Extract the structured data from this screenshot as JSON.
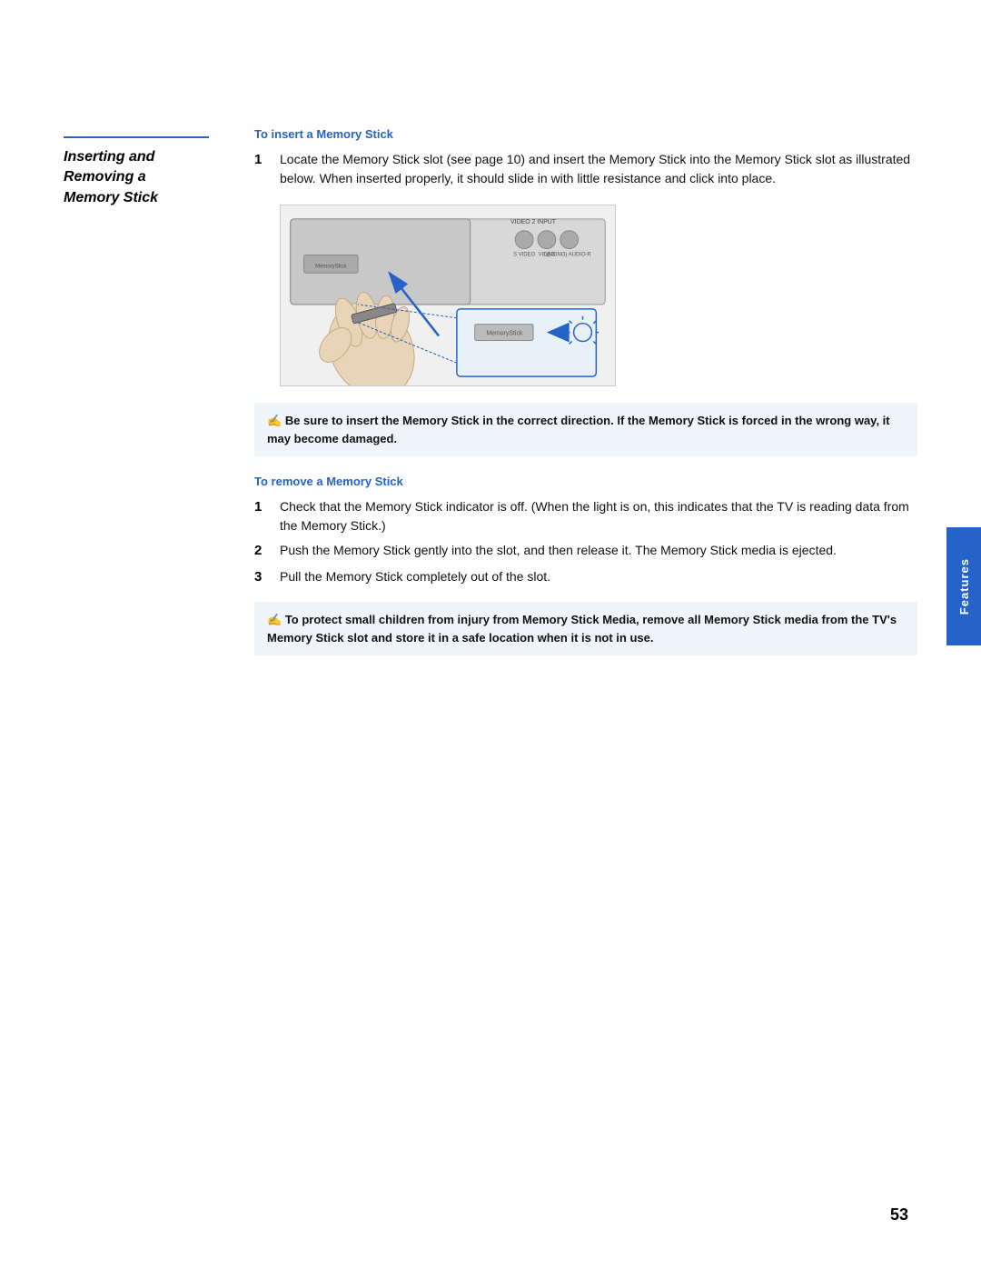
{
  "page": {
    "number": "53",
    "features_tab": "Features"
  },
  "section": {
    "title_line1": "Inserting and",
    "title_line2": "Removing a",
    "title_line3": "Memory Stick"
  },
  "insert_section": {
    "subtitle": "To insert a Memory Stick",
    "step1": "Locate the Memory Stick slot (see page 10) and insert the Memory Stick into the Memory Stick slot as illustrated below. When inserted properly, it should slide in with little resistance and click into place.",
    "note": "Be sure to insert the Memory Stick in the correct direction. If the Memory Stick is forced in the wrong way, it may become damaged."
  },
  "remove_section": {
    "subtitle": "To remove a Memory Stick",
    "step1": "Check that the Memory Stick indicator is off. (When the light is on, this indicates that the TV is reading data from the Memory Stick.)",
    "step2": "Push the Memory Stick gently into the slot, and then release it. The Memory Stick media is ejected.",
    "step3": "Pull the Memory Stick completely out of the slot.",
    "note": "To protect small children from injury from Memory Stick Media, remove all Memory Stick media from the TV's Memory Stick slot and store it in a safe location when it is not in use."
  }
}
